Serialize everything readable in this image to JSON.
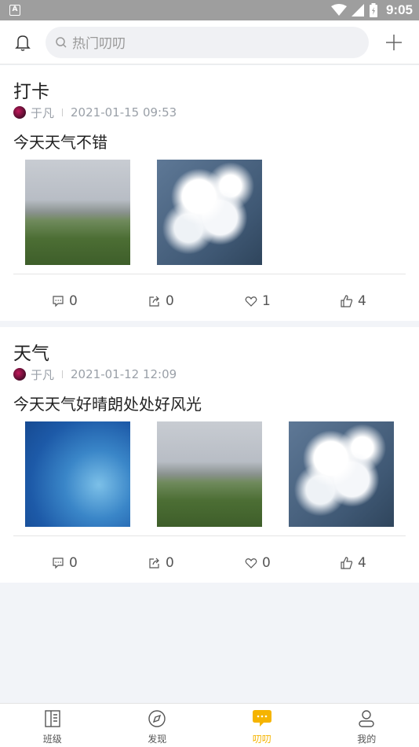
{
  "status_bar": {
    "app_badge": "A",
    "time": "9:05"
  },
  "top_bar": {
    "search_placeholder": "热门叨叨"
  },
  "posts": [
    {
      "title": "打卡",
      "author": "于凡",
      "timestamp": "2021-01-15 09:53",
      "body": "今天天气不错",
      "images": [
        "field-photo",
        "cloud-photo"
      ],
      "comments": "0",
      "shares": "0",
      "likes": "1",
      "thumbs": "4"
    },
    {
      "title": "天气",
      "author": "于凡",
      "timestamp": "2021-01-12 12:09",
      "body": "今天天气好晴朗处处好风光",
      "images": [
        "blue-photo",
        "field-photo",
        "cloud-photo"
      ],
      "comments": "0",
      "shares": "0",
      "likes": "0",
      "thumbs": "4"
    }
  ],
  "bottom_nav": [
    {
      "label": "班级",
      "icon": "class-icon",
      "active": false
    },
    {
      "label": "发现",
      "icon": "compass-icon",
      "active": false
    },
    {
      "label": "叨叨",
      "icon": "chat-bubble-icon",
      "active": true
    },
    {
      "label": "我的",
      "icon": "profile-icon",
      "active": false
    }
  ],
  "colors": {
    "accent": "#f5b400",
    "background": "#f2f4f8",
    "meta_text": "#9aa0a8"
  }
}
